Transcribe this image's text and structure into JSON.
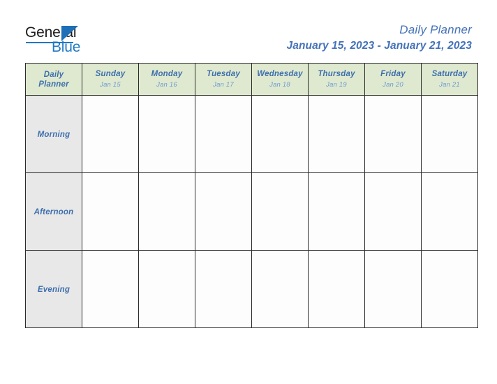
{
  "brand": {
    "name_part1": "General",
    "name_part2": "Blue",
    "triangle_color": "#1f6fb8",
    "text_color": "#1c1c1c",
    "blue_color": "#1f7ac4"
  },
  "header": {
    "title": "Daily Planner",
    "date_range": "January 15, 2023 - January 21, 2023",
    "title_color": "#4472b8"
  },
  "table": {
    "corner_label_line1": "Daily",
    "corner_label_line2": "Planner",
    "header_bg": "#dfe9cf",
    "label_bg": "#e8e8e8",
    "cell_bg": "#fdfdfd",
    "border_color": "#2b2b2b",
    "day_name_color": "#3d6fad",
    "day_date_color": "#6d9bd1",
    "columns": [
      {
        "day": "Sunday",
        "date": "Jan 15"
      },
      {
        "day": "Monday",
        "date": "Jan 16"
      },
      {
        "day": "Tuesday",
        "date": "Jan 17"
      },
      {
        "day": "Wednesday",
        "date": "Jan 18"
      },
      {
        "day": "Thursday",
        "date": "Jan 19"
      },
      {
        "day": "Friday",
        "date": "Jan 20"
      },
      {
        "day": "Saturday",
        "date": "Jan 21"
      }
    ],
    "rows": [
      {
        "label": "Morning",
        "cells": [
          "",
          "",
          "",
          "",
          "",
          "",
          ""
        ]
      },
      {
        "label": "Afternoon",
        "cells": [
          "",
          "",
          "",
          "",
          "",
          "",
          ""
        ]
      },
      {
        "label": "Evening",
        "cells": [
          "",
          "",
          "",
          "",
          "",
          "",
          ""
        ]
      }
    ]
  }
}
